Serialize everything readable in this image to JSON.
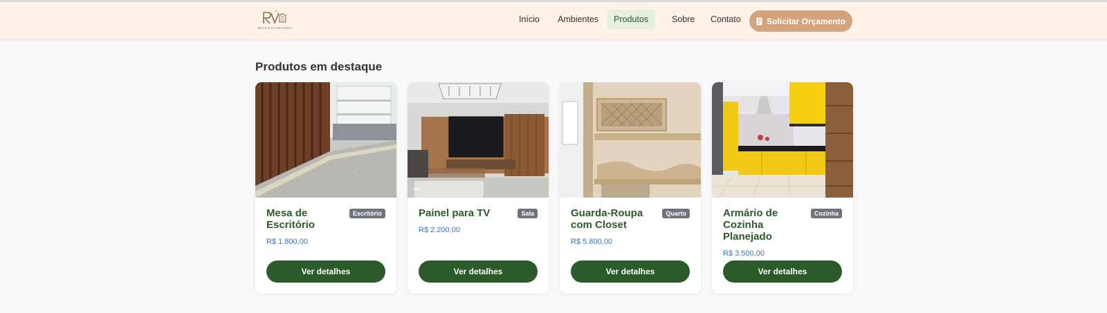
{
  "nav": {
    "logo_alt": "MÓVEIS PLANEJADOS",
    "links": [
      "Início",
      "Ambientes",
      "Produtos",
      "Sobre",
      "Contato"
    ],
    "active": "Produtos",
    "cta_label": "Solicitar Orçamento",
    "cta_icon": "document-icon"
  },
  "section": {
    "title": "Produtos em destaque"
  },
  "products": [
    {
      "name": "Mesa de Escritório",
      "tag": "Escritório",
      "price": "R$ 1.800,00",
      "button": "Ver detalhes"
    },
    {
      "name": "Painel para TV",
      "tag": "Sala",
      "price": "R$ 2.200,00",
      "button": "Ver detalhes"
    },
    {
      "name": "Guarda-Roupa com Closet",
      "tag": "Quarto",
      "price": "R$ 5.800,00",
      "button": "Ver detalhes"
    },
    {
      "name": "Armário de Cozinha Planejado",
      "tag": "Cozinha",
      "price": "R$ 3.500,00",
      "button": "Ver detalhes"
    }
  ],
  "colors": {
    "navbar_bg": "#fff2e8",
    "accent": "#d4a37b",
    "primary_green": "#2b5a2b",
    "price_blue": "#3d72b4",
    "badge_gray": "#6c757d"
  }
}
